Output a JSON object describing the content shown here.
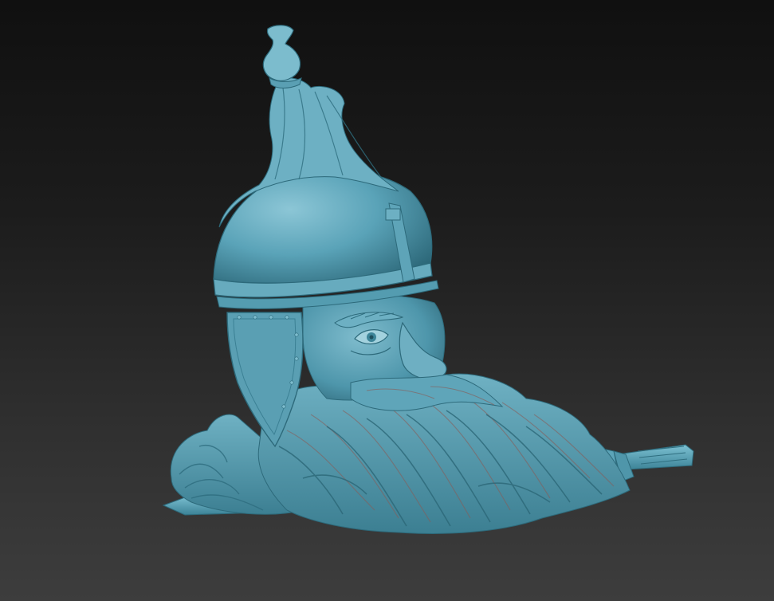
{
  "viewport": {
    "background_top": "#101010",
    "background_bottom": "#3d3d3d"
  },
  "model": {
    "subject": "sculpted-warrior-head",
    "material_color": "#5aa3b8",
    "material_shadow": "#1f4f5e",
    "material_highlight": "#9fd4e2",
    "cavity_color": "#8a5a55",
    "parts": [
      "helmet-finial",
      "helmet-plume",
      "helmet-dome",
      "helmet-band",
      "cheek-guard",
      "face",
      "eye",
      "nose",
      "eyebrow",
      "mustache",
      "beard",
      "hair",
      "sword-blade-left",
      "sword-hilt-right"
    ]
  }
}
